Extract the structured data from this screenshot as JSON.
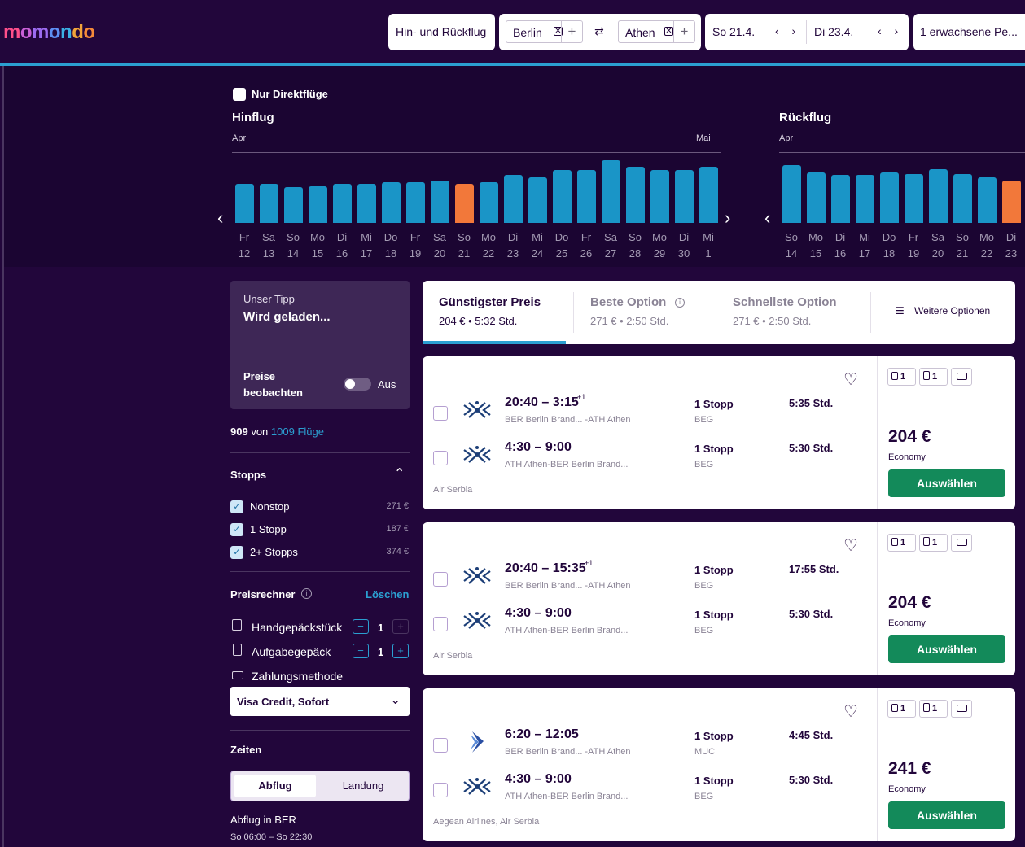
{
  "header": {
    "logo": "momondo",
    "trip_type": "Hin- und Rückflug",
    "origin": "Berlin",
    "destination": "Athen",
    "depart_date": "So 21.4.",
    "return_date": "Di 23.4.",
    "passengers": "1 erwachsene Pe...",
    "swap_icon": "⇄",
    "chip_remove": "✕",
    "chip_add": "+",
    "date_nav": "‹ ›"
  },
  "calendar": {
    "direct_only_label": "Nur Direktflüge",
    "outbound": {
      "title": "Hinflug",
      "month_start": "Apr",
      "month_end": "Mai",
      "prev": "‹",
      "next": "›",
      "days": [
        {
          "dow": "Fr",
          "day": "12",
          "level": 0.62
        },
        {
          "dow": "Sa",
          "day": "13",
          "level": 0.62
        },
        {
          "dow": "So",
          "day": "14",
          "level": 0.57
        },
        {
          "dow": "Mo",
          "day": "15",
          "level": 0.59
        },
        {
          "dow": "Di",
          "day": "16",
          "level": 0.62
        },
        {
          "dow": "Mi",
          "day": "17",
          "level": 0.62
        },
        {
          "dow": "Do",
          "day": "18",
          "level": 0.65
        },
        {
          "dow": "Fr",
          "day": "19",
          "level": 0.65
        },
        {
          "dow": "Sa",
          "day": "20",
          "level": 0.68
        },
        {
          "dow": "So",
          "day": "21",
          "level": 0.62,
          "selected": true
        },
        {
          "dow": "Mo",
          "day": "22",
          "level": 0.65
        },
        {
          "dow": "Di",
          "day": "23",
          "level": 0.76
        },
        {
          "dow": "Mi",
          "day": "24",
          "level": 0.73
        },
        {
          "dow": "Do",
          "day": "25",
          "level": 0.84
        },
        {
          "dow": "Fr",
          "day": "26",
          "level": 0.84
        },
        {
          "dow": "Sa",
          "day": "27",
          "level": 1.0
        },
        {
          "dow": "So",
          "day": "28",
          "level": 0.89
        },
        {
          "dow": "Mo",
          "day": "29",
          "level": 0.84
        },
        {
          "dow": "Di",
          "day": "30",
          "level": 0.84
        },
        {
          "dow": "Mi",
          "day": "1",
          "level": 0.89
        }
      ]
    },
    "inbound": {
      "title": "Rückflug",
      "month_start": "Apr",
      "prev": "‹",
      "days": [
        {
          "dow": "So",
          "day": "14",
          "level": 0.92
        },
        {
          "dow": "Mo",
          "day": "15",
          "level": 0.81
        },
        {
          "dow": "Di",
          "day": "16",
          "level": 0.76
        },
        {
          "dow": "Mi",
          "day": "17",
          "level": 0.76
        },
        {
          "dow": "Do",
          "day": "18",
          "level": 0.81
        },
        {
          "dow": "Fr",
          "day": "19",
          "level": 0.78
        },
        {
          "dow": "Sa",
          "day": "20",
          "level": 0.86
        },
        {
          "dow": "So",
          "day": "21",
          "level": 0.78
        },
        {
          "dow": "Mo",
          "day": "22",
          "level": 0.73
        },
        {
          "dow": "Di",
          "day": "23",
          "level": 0.68,
          "selected": true
        }
      ]
    }
  },
  "sidebar": {
    "tip_label": "Unser Tipp",
    "tip_value": "Wird geladen...",
    "watch_label_1": "Preise",
    "watch_label_2": "beobachten",
    "watch_state": "Aus",
    "count_shown": "909",
    "count_sep": "von",
    "count_total": "1009 Flüge",
    "stops_title": "Stopps",
    "stops": [
      {
        "label": "Nonstop",
        "price": "271 €"
      },
      {
        "label": "1 Stopp",
        "price": "187 €"
      },
      {
        "label": "2+ Stopps",
        "price": "374 €"
      }
    ],
    "calc_title": "Preisrechner",
    "calc_clear": "Löschen",
    "carry_on_label": "Handgepäckstück",
    "carry_on_count": "1",
    "checked_label": "Aufgabegepäck",
    "checked_count": "1",
    "payment_label": "Zahlungsmethode",
    "payment_value": "Visa Credit, Sofort",
    "times_title": "Zeiten",
    "tab_depart": "Abflug",
    "tab_land": "Landung",
    "depart_in": "Abflug in BER",
    "depart_range": "So 06:00 – So 22:30"
  },
  "sort": {
    "cheapest_title": "Günstigster Preis",
    "cheapest_sub": "204 € • 5:32 Std.",
    "best_title": "Beste Option",
    "best_sub": "271 € • 2:50 Std.",
    "fastest_title": "Schnellste Option",
    "fastest_sub": "271 € • 2:50 Std.",
    "more": "Weitere Optionen"
  },
  "results": [
    {
      "out_time": "20:40 – 3:15",
      "out_plus": "+1",
      "out_route": "BER Berlin Brand... -ATH Athen",
      "out_stops": "1 Stopp",
      "out_via": "BEG",
      "out_dur": "5:35 Std.",
      "ret_time": "4:30 – 9:00",
      "ret_route": "ATH Athen-BER Berlin Brand...",
      "ret_stops": "1 Stopp",
      "ret_via": "BEG",
      "ret_dur": "5:30 Std.",
      "carrier": "Air Serbia",
      "price": "204 €",
      "cabin": "Economy",
      "select": "Auswählen",
      "bag1": "1",
      "bag2": "1"
    },
    {
      "out_time": "20:40 – 15:35",
      "out_plus": "+1",
      "out_route": "BER Berlin Brand... -ATH Athen",
      "out_stops": "1 Stopp",
      "out_via": "BEG",
      "out_dur": "17:55 Std.",
      "ret_time": "4:30 – 9:00",
      "ret_route": "ATH Athen-BER Berlin Brand...",
      "ret_stops": "1 Stopp",
      "ret_via": "BEG",
      "ret_dur": "5:30 Std.",
      "carrier": "Air Serbia",
      "price": "204 €",
      "cabin": "Economy",
      "select": "Auswählen",
      "bag1": "1",
      "bag2": "1"
    },
    {
      "out_time": "6:20 – 12:05",
      "out_plus": "",
      "out_route": "BER Berlin Brand... -ATH Athen",
      "out_stops": "1 Stopp",
      "out_via": "MUC",
      "out_dur": "4:45 Std.",
      "ret_time": "4:30 – 9:00",
      "ret_route": "ATH Athen-BER Berlin Brand...",
      "ret_stops": "1 Stopp",
      "ret_via": "BEG",
      "ret_dur": "5:30 Std.",
      "carrier": "Aegean Airlines, Air Serbia",
      "price": "241 €",
      "cabin": "Economy",
      "select": "Auswählen",
      "bag1": "1",
      "bag2": "1"
    }
  ],
  "colors": {
    "accent": "#2b9fd1",
    "bar": "#1a95c7",
    "bar_selected": "#f2783a",
    "select_button": "#138a5a",
    "background": "#22063b"
  }
}
